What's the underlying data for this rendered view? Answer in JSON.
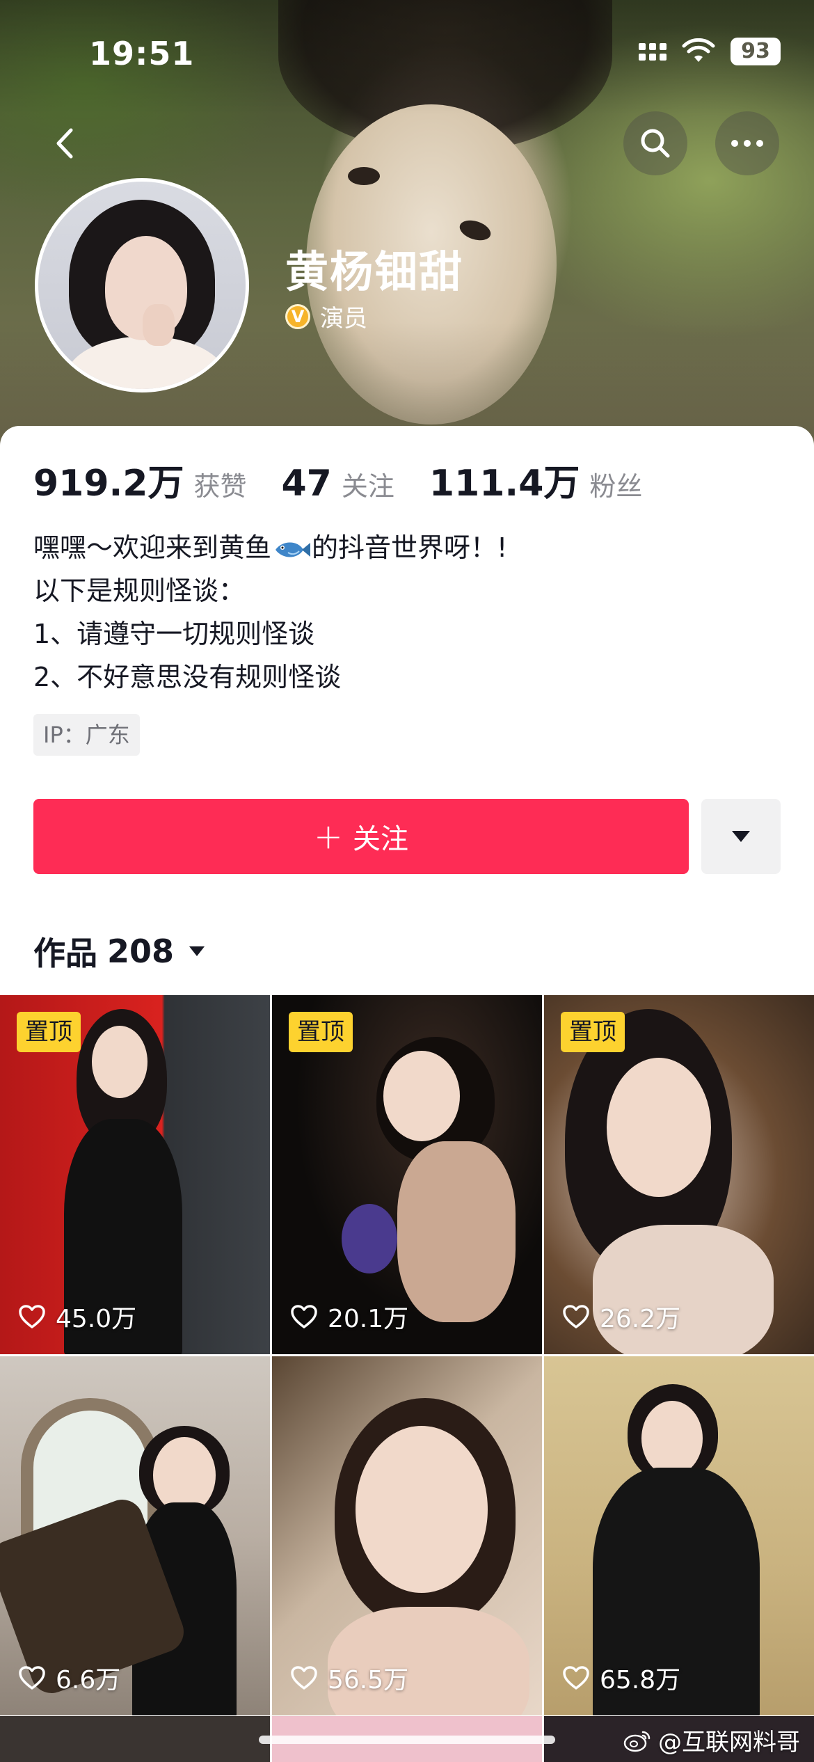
{
  "status_bar": {
    "time": "19:51",
    "battery": "93"
  },
  "profile": {
    "name": "黄杨钿甜",
    "verified_badge": "V",
    "verified_label": "演员"
  },
  "stats": {
    "likes": {
      "value": "919.2万",
      "label": "获赞"
    },
    "following": {
      "value": "47",
      "label": "关注"
    },
    "followers": {
      "value": "111.4万",
      "label": "粉丝"
    }
  },
  "bio": {
    "line1_before": "嘿嘿～欢迎来到黄鱼",
    "line1_after": "的抖音世界呀！!",
    "line2": "以下是规则怪谈：",
    "line3": "1、请遵守一切规则怪谈",
    "line4": "2、不好意思没有规则怪谈"
  },
  "ip": "IP：广东",
  "follow_button": {
    "icon": "+",
    "label": "关注"
  },
  "works": {
    "label": "作品",
    "count": "208"
  },
  "videos": [
    {
      "pinned": "置顶",
      "likes": "45.0万"
    },
    {
      "pinned": "置顶",
      "likes": "20.1万"
    },
    {
      "pinned": "置顶",
      "likes": "26.2万"
    },
    {
      "pinned": "",
      "likes": "6.6万"
    },
    {
      "pinned": "",
      "likes": "56.5万"
    },
    {
      "pinned": "",
      "likes": "65.8万"
    }
  ],
  "watermark": "@互联网料哥",
  "colors": {
    "accent": "#fe2c55",
    "pin_badge": "#fdd22f",
    "verified": "#f6b42a"
  }
}
